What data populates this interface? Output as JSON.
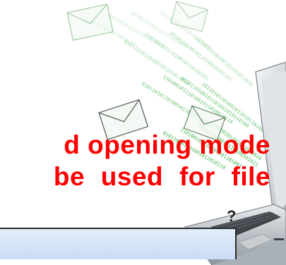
{
  "slide": {
    "line1": "d opening mode",
    "line2": "be used for file",
    "text_color": "#ff0000"
  },
  "bottom_bar": {
    "mark": "?",
    "fill_color": "#c9dbf5",
    "border_color": "#2b2b2b"
  },
  "illustration": {
    "icons": [
      "envelope-icon",
      "envelope-icon",
      "envelope-icon",
      "envelope-icon",
      "laptop-icon"
    ],
    "accent_color": "#2eaa3c"
  }
}
